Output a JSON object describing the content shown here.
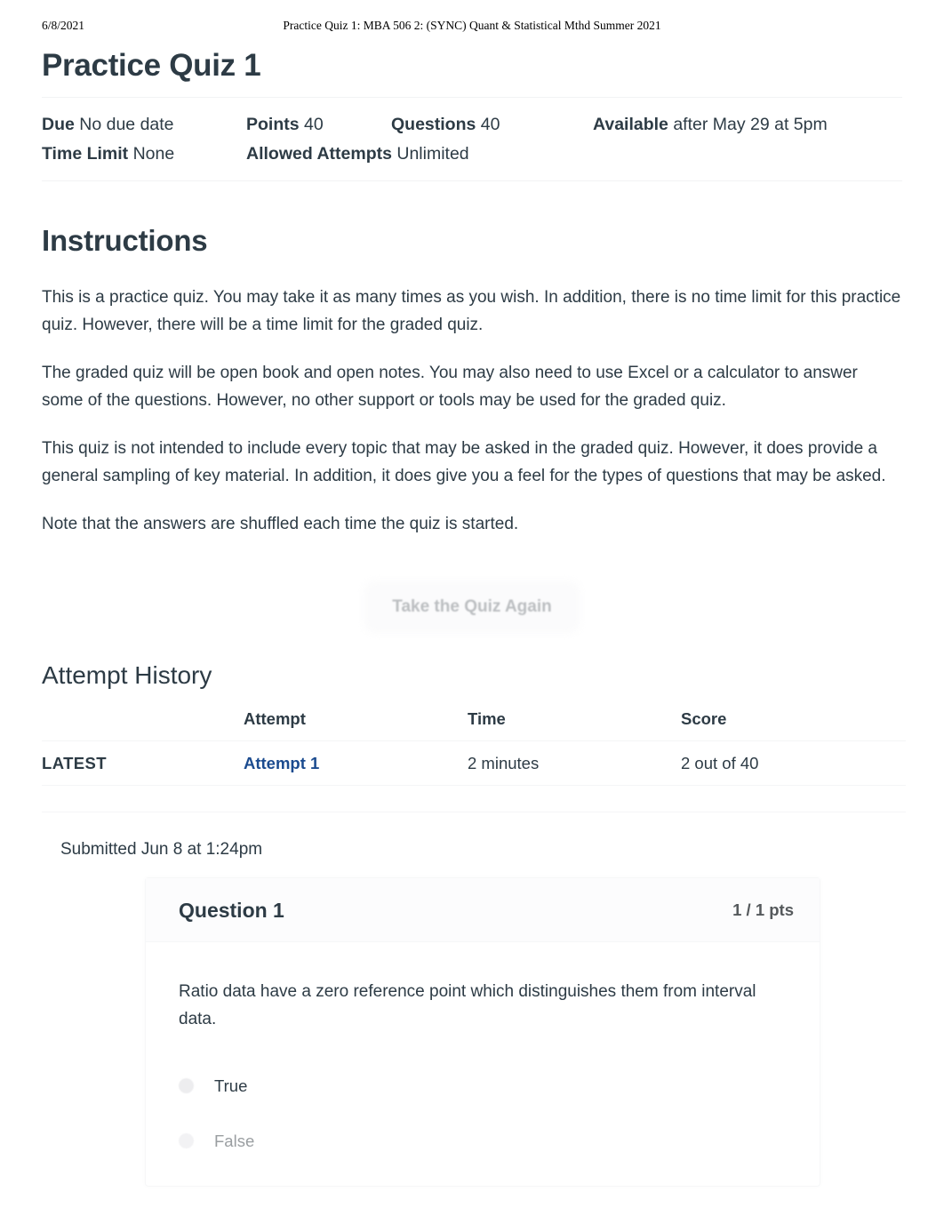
{
  "print_header": {
    "date": "6/8/2021",
    "title": "Practice Quiz 1: MBA 506 2: (SYNC) Quant & Statistical Mthd Summer 2021"
  },
  "quiz": {
    "title": "Practice Quiz 1",
    "meta": {
      "due_label": "Due",
      "due_value": "No due date",
      "points_label": "Points",
      "points_value": "40",
      "questions_label": "Questions",
      "questions_value": "40",
      "available_label": "Available",
      "available_value": "after May 29 at 5pm",
      "time_limit_label": "Time Limit",
      "time_limit_value": "None",
      "allowed_attempts_label": "Allowed Attempts",
      "allowed_attempts_value": "Unlimited"
    }
  },
  "instructions": {
    "heading": "Instructions",
    "paragraphs": [
      "This is a practice quiz. You may take it as many times as you wish. In addition, there is no time limit for this practice quiz. However, there will be a time limit for the graded quiz.",
      "The graded quiz will be open book and open notes. You may also need to use Excel or a calculator to answer some of the questions. However, no other support or tools may be used for the graded quiz.",
      "This quiz is not intended to include every topic that may be asked in the graded quiz. However, it does provide a general sampling of key material. In addition, it does give you a feel for the types of questions that may be asked.",
      "Note that the answers are shuffled each time the quiz is started."
    ]
  },
  "actions": {
    "retake_label": "Take the Quiz Again"
  },
  "attempt_history": {
    "heading": "Attempt History",
    "columns": {
      "marker": "",
      "attempt": "Attempt",
      "time": "Time",
      "score": "Score"
    },
    "rows": [
      {
        "marker": "LATEST",
        "attempt": "Attempt 1",
        "time": "2 minutes",
        "score": "2 out of 40"
      }
    ],
    "submitted": "Submitted Jun 8 at 1:24pm"
  },
  "question": {
    "name": "Question 1",
    "points": "1 / 1 pts",
    "text": "Ratio data have a zero reference point which distinguishes them from interval data.",
    "answers": [
      {
        "label": "True",
        "selected": true
      },
      {
        "label": "False",
        "selected": false
      }
    ]
  },
  "colors": {
    "text": "#2d3b45",
    "link": "#1b4b8f",
    "muted": "#9a9ea1",
    "divider": "#f4f5f6"
  }
}
